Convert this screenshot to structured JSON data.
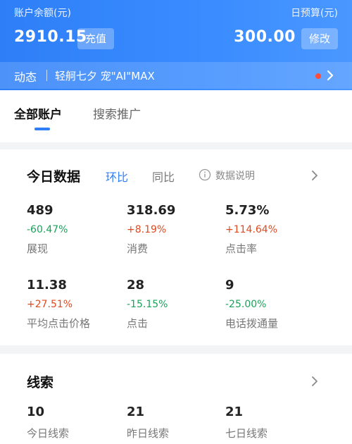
{
  "header": {
    "balance_label": "账户余额(元)",
    "balance_value": "2910.15",
    "recharge_label": "充值",
    "budget_label": "日预算(元)",
    "budget_value": "300.00",
    "modify_label": "修改"
  },
  "news": {
    "title": "动态",
    "text": "轻舸七夕 宠\"AI\"MAX"
  },
  "tabs": [
    {
      "label": "全部账户"
    },
    {
      "label": "搜索推广"
    }
  ],
  "today": {
    "title": "今日数据",
    "compare_hb": "环比",
    "compare_tb": "同比",
    "info_text": "数据说明",
    "metrics": [
      {
        "value": "489",
        "change": "-60.47%",
        "label": "展现"
      },
      {
        "value": "318.69",
        "change": "+8.19%",
        "label": "消费"
      },
      {
        "value": "5.73%",
        "change": "+114.64%",
        "label": "点击率"
      },
      {
        "value": "11.38",
        "change": "+27.51%",
        "label": "平均点击价格"
      },
      {
        "value": "28",
        "change": "-15.15%",
        "label": "点击"
      },
      {
        "value": "9",
        "change": "-25.00%",
        "label": "电话拨通量"
      }
    ]
  },
  "leads": {
    "title": "线索",
    "metrics": [
      {
        "value": "10",
        "label": "今日线索"
      },
      {
        "value": "21",
        "label": "昨日线索"
      },
      {
        "value": "21",
        "label": "七日线索"
      }
    ]
  },
  "colors": {
    "brand_blue": "#2e7ff7",
    "up_red": "#e0491f",
    "down_green": "#19a35a",
    "dot_red": "#ff4d3a"
  }
}
